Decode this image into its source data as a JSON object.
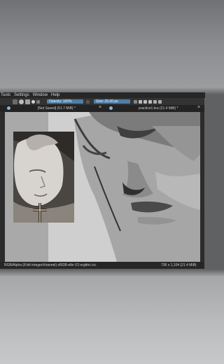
{
  "menu": [
    "Tools",
    "Settings",
    "Window",
    "Help"
  ],
  "toolbar": {
    "opacity_label": "Opacity: 100%",
    "size_label": "Size: 25.00 px"
  },
  "tabs": [
    {
      "label": "[Not Saved] (51.7 MiB) *"
    },
    {
      "label": "practice1.kra (21.4 MiB) *"
    }
  ],
  "status": {
    "color_info": "RGB/Alpha (8-bit integer/channel)  sRGB-elle-V2-srgbtrc.icc",
    "dimensions": "736 x 1,104 (21.4 MiB)"
  },
  "colors": {
    "accent": "#4e7fa8",
    "canvas_bg": "#848484",
    "ui_dark": "#2a2a2a"
  },
  "icons": [
    "brush-preset-icon",
    "gradient-icon",
    "pattern-icon",
    "eraser-icon",
    "mirror-icon",
    "wrap-icon",
    "undo-icon",
    "redo-icon",
    "close-icon"
  ]
}
